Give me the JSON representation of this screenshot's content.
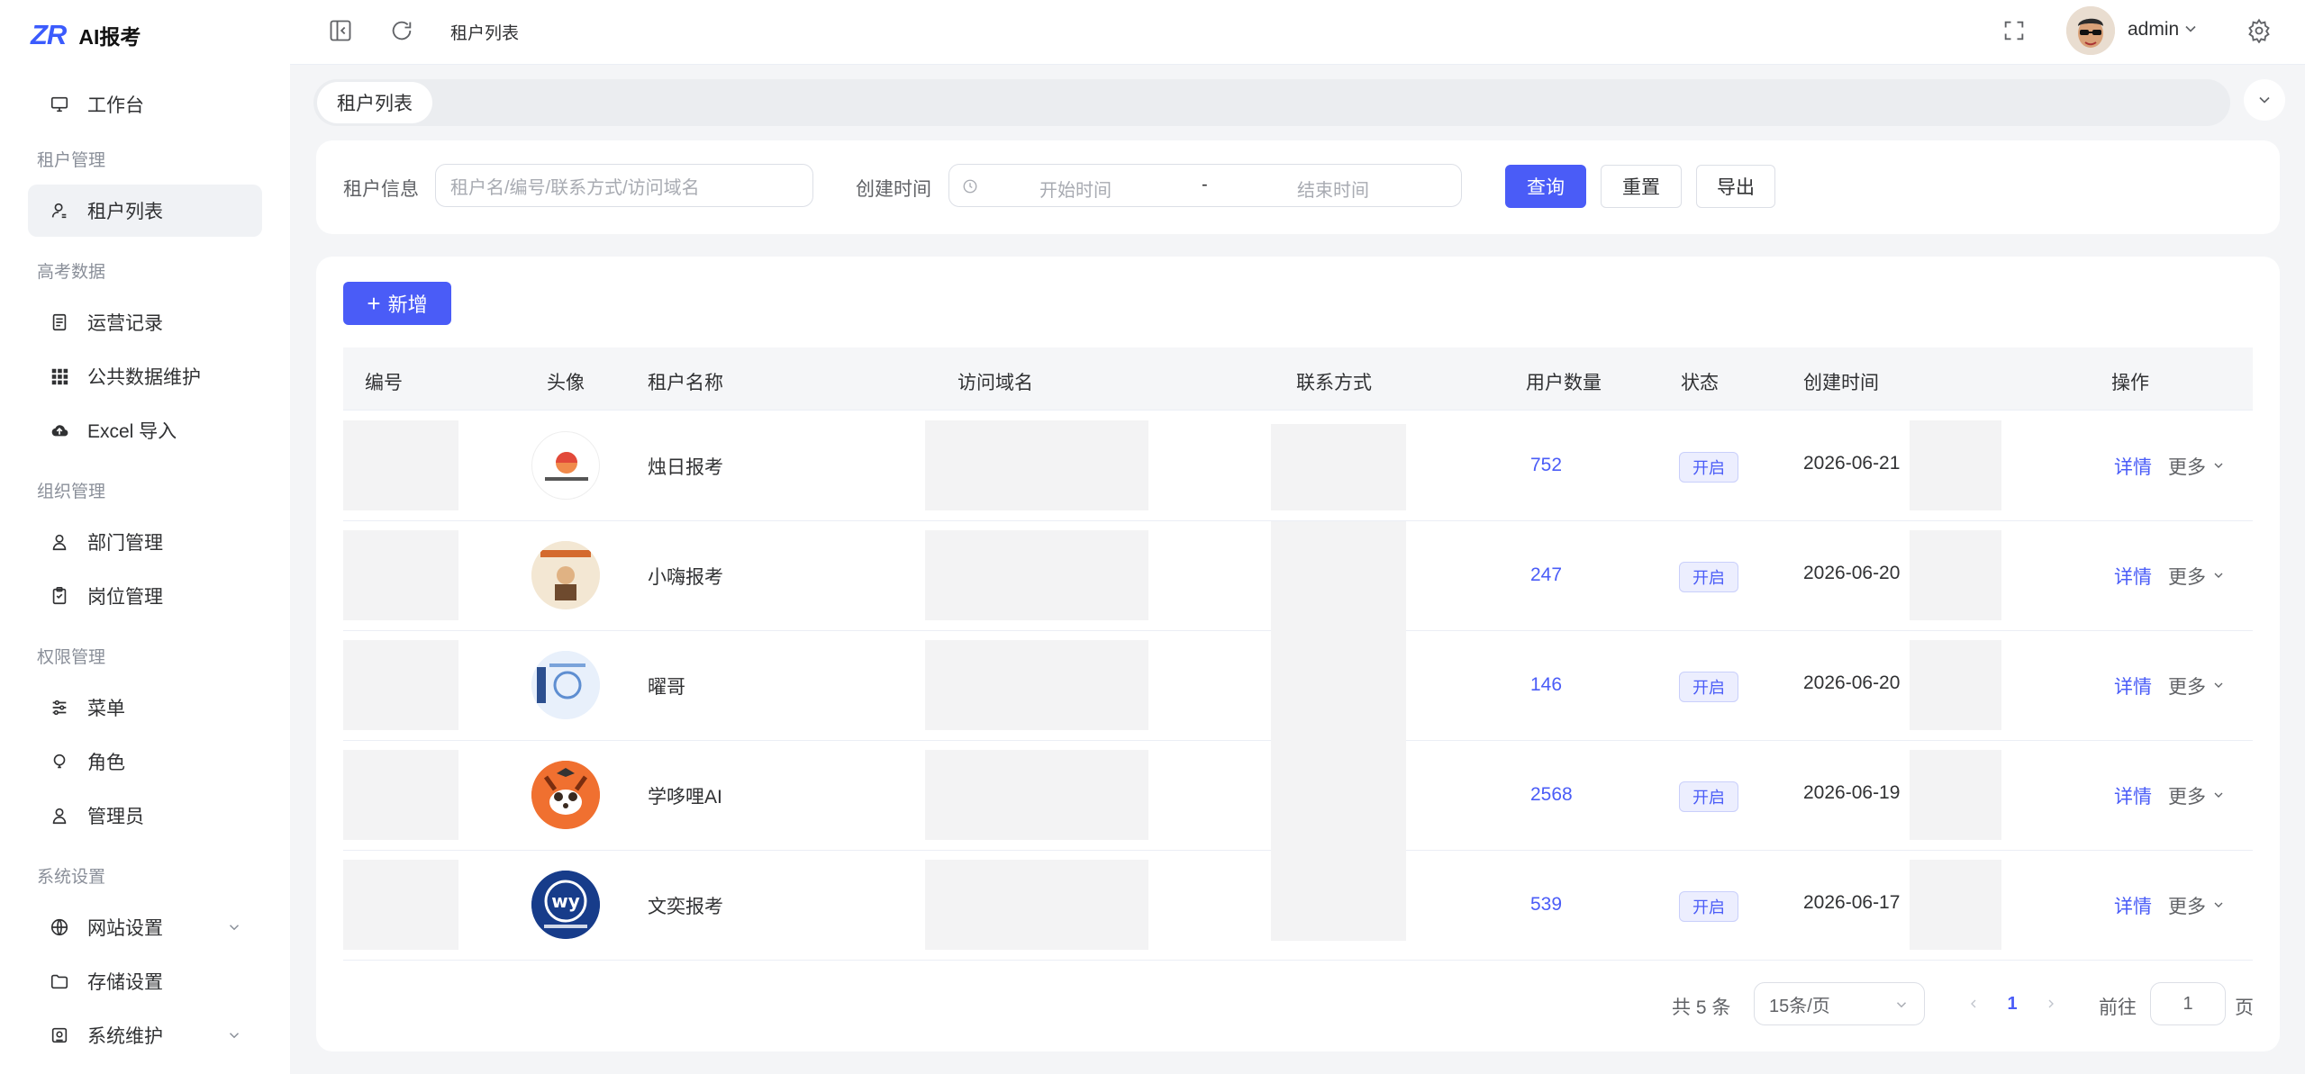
{
  "brand": {
    "logo": "ZR",
    "name": "AI报考"
  },
  "sidebar": {
    "workbench": "工作台",
    "groups": [
      {
        "title": "租户管理",
        "items": [
          {
            "label": "租户列表",
            "icon": "tenant-icon",
            "active": true
          }
        ]
      },
      {
        "title": "高考数据",
        "items": [
          {
            "label": "运营记录",
            "icon": "document-icon"
          },
          {
            "label": "公共数据维护",
            "icon": "grid-icon"
          },
          {
            "label": "Excel 导入",
            "icon": "cloud-upload-icon"
          }
        ]
      },
      {
        "title": "组织管理",
        "items": [
          {
            "label": "部门管理",
            "icon": "department-icon"
          },
          {
            "label": "岗位管理",
            "icon": "clipboard-icon"
          }
        ]
      },
      {
        "title": "权限管理",
        "items": [
          {
            "label": "菜单",
            "icon": "sliders-icon"
          },
          {
            "label": "角色",
            "icon": "bulb-icon"
          },
          {
            "label": "管理员",
            "icon": "user-icon"
          }
        ]
      },
      {
        "title": "系统设置",
        "items": [
          {
            "label": "网站设置",
            "icon": "globe-icon",
            "expandable": true
          },
          {
            "label": "存储设置",
            "icon": "folder-icon"
          },
          {
            "label": "系统维护",
            "icon": "maintenance-icon",
            "expandable": true
          }
        ]
      }
    ]
  },
  "header": {
    "breadcrumb": "租户列表",
    "user": "admin"
  },
  "tabs": [
    "租户列表"
  ],
  "search": {
    "tenant_label": "租户信息",
    "tenant_placeholder": "租户名/编号/联系方式/访问域名",
    "time_label": "创建时间",
    "start_placeholder": "开始时间",
    "separator": "-",
    "end_placeholder": "结束时间",
    "query": "查询",
    "reset": "重置",
    "export": "导出"
  },
  "table": {
    "add_label": "新增",
    "columns": {
      "id": "编号",
      "avatar": "头像",
      "name": "租户名称",
      "domain": "访问域名",
      "contact": "联系方式",
      "users": "用户数量",
      "status": "状态",
      "created": "创建时间",
      "ops": "操作"
    },
    "rows": [
      {
        "name": "烛日报考",
        "users": "752",
        "status": "开启",
        "created": "2026-06-21",
        "detail": "详情",
        "more": "更多"
      },
      {
        "name": "小嗨报考",
        "users": "247",
        "status": "开启",
        "created": "2026-06-20",
        "detail": "详情",
        "more": "更多"
      },
      {
        "name": "曜哥",
        "users": "146",
        "status": "开启",
        "created": "2026-06-20",
        "detail": "详情",
        "more": "更多"
      },
      {
        "name": "学哆哩AI",
        "users": "2568",
        "status": "开启",
        "created": "2026-06-19",
        "detail": "详情",
        "more": "更多"
      },
      {
        "name": "文奕报考",
        "users": "539",
        "status": "开启",
        "created": "2026-06-17",
        "detail": "详情",
        "more": "更多"
      }
    ]
  },
  "pagination": {
    "total": "共 5 条",
    "page_size": "15条/页",
    "current": "1",
    "goto_label": "前往",
    "goto_value": "1",
    "page_suffix": "页"
  },
  "colors": {
    "primary": "#4a5cf7",
    "bg": "#f4f5f7"
  }
}
